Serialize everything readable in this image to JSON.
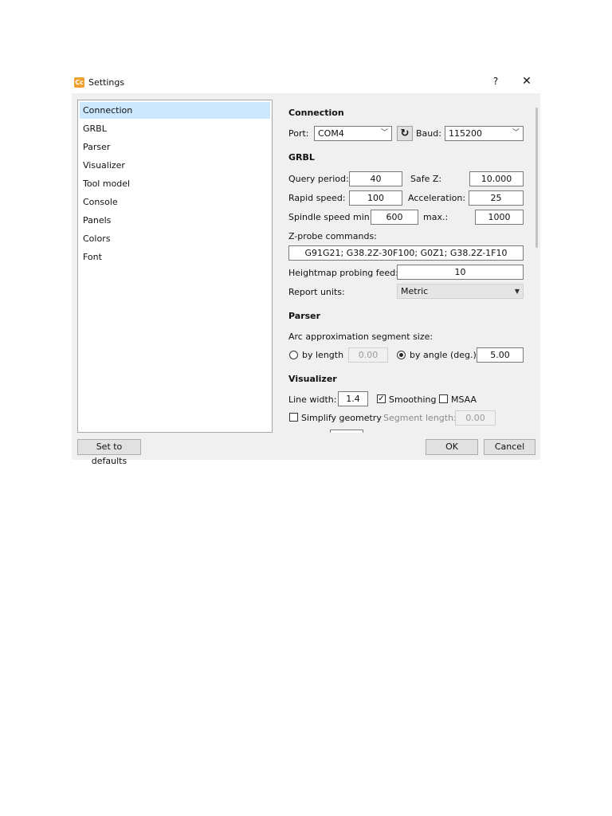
{
  "window": {
    "title": "Settings",
    "help": "?",
    "close": "✕",
    "app_icon": "Cc"
  },
  "nav": {
    "items": [
      "Connection",
      "GRBL",
      "Parser",
      "Visualizer",
      "Tool model",
      "Console",
      "Panels",
      "Colors",
      "Font"
    ],
    "selected": 0
  },
  "connection": {
    "heading": "Connection",
    "port_label": "Port:",
    "port_value": "COM4",
    "baud_label": "Baud:",
    "baud_value": "115200",
    "refresh_icon": "refresh-icon"
  },
  "grbl": {
    "heading": "GRBL",
    "query_period_label": "Query period:",
    "query_period": "40",
    "safe_z_label": "Safe Z:",
    "safe_z": "10.000",
    "rapid_speed_label": "Rapid speed:",
    "rapid_speed": "100",
    "acceleration_label": "Acceleration:",
    "acceleration": "25",
    "spindle_min_label": "Spindle speed min.:",
    "spindle_min": "600",
    "spindle_max_label": "max.:",
    "spindle_max": "1000",
    "zprobe_label": "Z-probe commands:",
    "zprobe": "G91G21; G38.2Z-30F100; G0Z1; G38.2Z-1F10",
    "heightmap_label": "Heightmap probing feed:",
    "heightmap_feed": "10",
    "report_units_label": "Report units:",
    "report_units": "Metric"
  },
  "parser": {
    "heading": "Parser",
    "arc_label": "Arc approximation segment size:",
    "by_length_label": "by length",
    "by_length_value": "0.00",
    "by_angle_label": "by angle (deg.)",
    "by_angle_value": "5.00"
  },
  "visualizer": {
    "heading": "Visualizer",
    "line_width_label": "Line width:",
    "line_width": "1.4",
    "smoothing_label": "Smoothing",
    "msaa_label": "MSAA",
    "simplify_label": "Simplify geometry",
    "segment_length_label": "Segment length:",
    "segment_length": "0.00"
  },
  "buttons": {
    "defaults": "Set to defaults",
    "ok": "OK",
    "cancel": "Cancel"
  }
}
